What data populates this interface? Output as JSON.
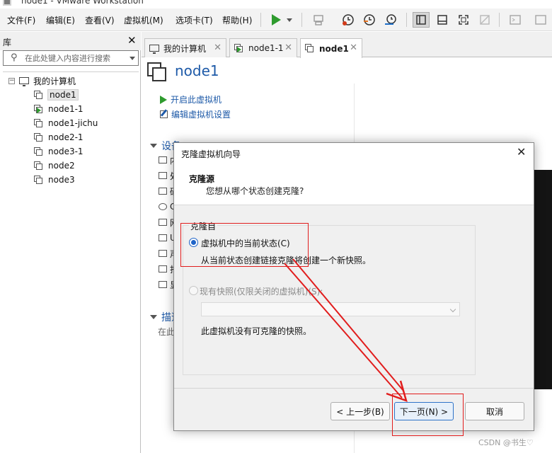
{
  "window": {
    "title": "node1 - VMware Workstation"
  },
  "menubar": {
    "items": [
      "文件(F)",
      "编辑(E)",
      "查看(V)",
      "虚拟机(M)",
      "选项卡(T)",
      "帮助(H)"
    ]
  },
  "library": {
    "title": "库",
    "search_placeholder": "在此处键入内容进行搜索",
    "root_label": "我的计算机",
    "vms": [
      {
        "name": "node1",
        "running": false,
        "selected": true
      },
      {
        "name": "node1-1",
        "running": true,
        "selected": false
      },
      {
        "name": "node1-jichu",
        "running": false,
        "selected": false
      },
      {
        "name": "node2-1",
        "running": false,
        "selected": false
      },
      {
        "name": "node3-1",
        "running": false,
        "selected": false
      },
      {
        "name": "node2",
        "running": false,
        "selected": false
      },
      {
        "name": "node3",
        "running": false,
        "selected": false
      }
    ]
  },
  "tabs": [
    {
      "label": "我的计算机",
      "active": false
    },
    {
      "label": "node1-1",
      "active": false
    },
    {
      "label": "node1",
      "active": true
    }
  ],
  "main": {
    "vm_title": "node1",
    "actions": {
      "start": "开启此虚拟机",
      "edit": "编辑虚拟机设置"
    },
    "devices_header": "设备",
    "devices_partial": [
      "内",
      "处",
      "硬",
      "C",
      "网",
      "U",
      "声",
      "打",
      "显"
    ],
    "description_header": "描述",
    "description_partial": "在此"
  },
  "dialog": {
    "title": "克隆虚拟机向导",
    "header_title": "克隆源",
    "header_subtitle": "您想从哪个状态创建克隆?",
    "group_label": "克隆自",
    "option_current": "虚拟机中的当前状态(C)",
    "option_current_desc": "从当前状态创建链接克隆将创建一个新快照。",
    "option_snapshot": "现有快照(仅限关闭的虚拟机)(S):",
    "no_snapshot_msg": "此虚拟机没有可克隆的快照。",
    "buttons": {
      "back": "< 上一步(B)",
      "next": "下一页(N) >",
      "cancel": "取消"
    }
  },
  "watermark": "CSDN @书生♡",
  "colors": {
    "accent_blue": "#1e5aa8",
    "run_green": "#2e9b2e",
    "annotation_red": "#e11d1d"
  }
}
